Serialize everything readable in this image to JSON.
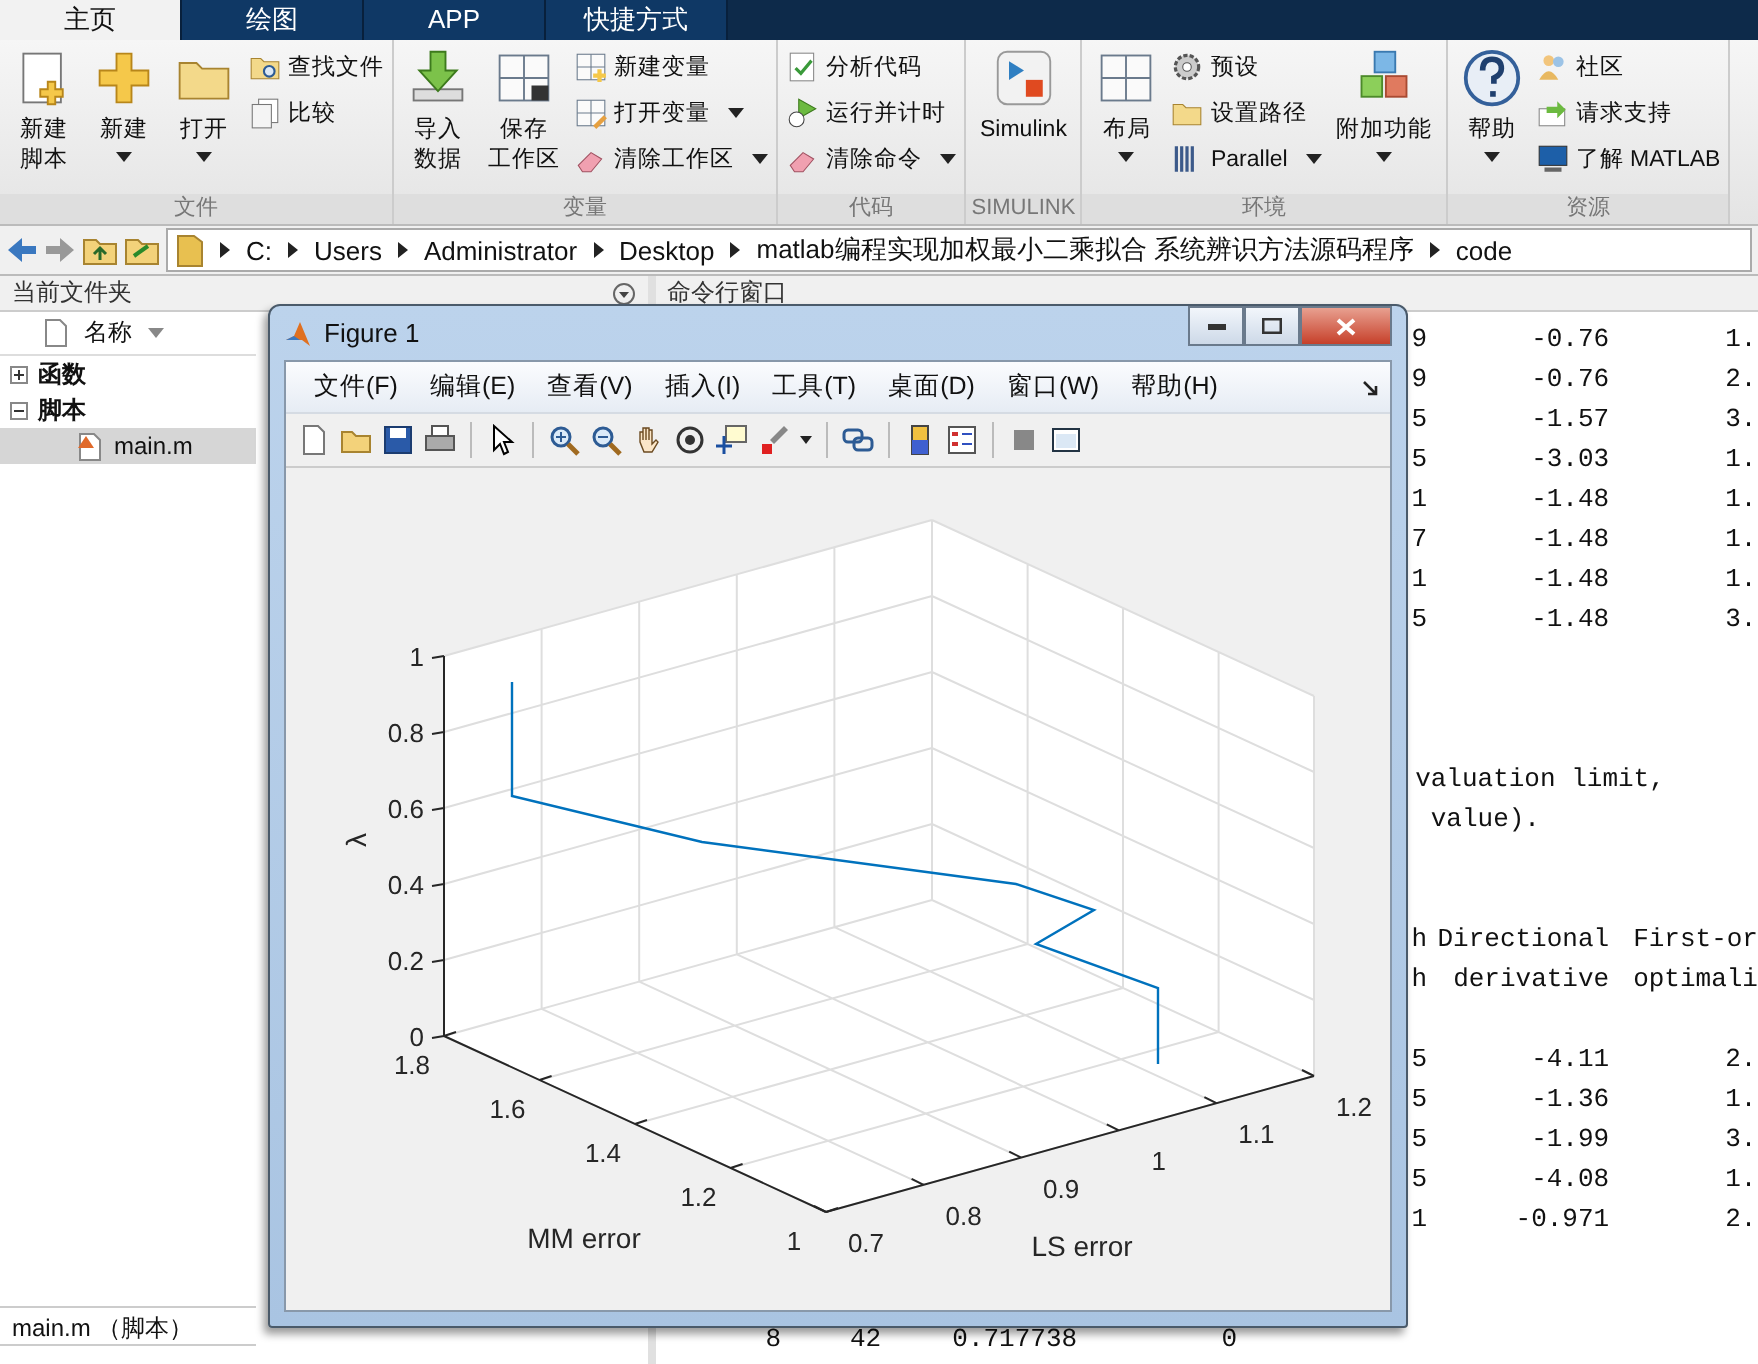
{
  "tabs": [
    {
      "label": "主页",
      "selected": true
    },
    {
      "label": "绘图",
      "selected": false
    },
    {
      "label": "APP",
      "selected": false
    },
    {
      "label": "快捷方式",
      "selected": false
    }
  ],
  "ribbon": {
    "groups": [
      {
        "label": "文件",
        "items": [
          {
            "kind": "large",
            "lines": [
              "新建",
              "脚本"
            ],
            "dropdown": false
          },
          {
            "kind": "large",
            "lines": [
              "新建"
            ],
            "dropdown": true
          },
          {
            "kind": "large",
            "lines": [
              "打开"
            ],
            "dropdown": true
          },
          {
            "kind": "stack",
            "items": [
              {
                "label": "查找文件",
                "dropdown": false
              },
              {
                "label": "比较",
                "dropdown": false
              }
            ]
          }
        ]
      },
      {
        "label": "变量",
        "items": [
          {
            "kind": "large",
            "lines": [
              "导入",
              "数据"
            ],
            "dropdown": false
          },
          {
            "kind": "large",
            "lines": [
              "保存",
              "工作区"
            ],
            "dropdown": false
          },
          {
            "kind": "stack",
            "items": [
              {
                "label": "新建变量",
                "dropdown": false
              },
              {
                "label": "打开变量",
                "dropdown": true
              },
              {
                "label": "清除工作区",
                "dropdown": true
              }
            ]
          }
        ]
      },
      {
        "label": "代码",
        "items": [
          {
            "kind": "stack",
            "items": [
              {
                "label": "分析代码",
                "dropdown": false
              },
              {
                "label": "运行并计时",
                "dropdown": false
              },
              {
                "label": "清除命令",
                "dropdown": true
              }
            ]
          }
        ]
      },
      {
        "label": "SIMULINK",
        "items": [
          {
            "kind": "large",
            "lines": [
              "Simulink"
            ],
            "dropdown": false
          }
        ]
      },
      {
        "label": "环境",
        "items": [
          {
            "kind": "large",
            "lines": [
              "布局"
            ],
            "dropdown": true
          },
          {
            "kind": "stack",
            "items": [
              {
                "label": "预设",
                "dropdown": false
              },
              {
                "label": "设置路径",
                "dropdown": false
              },
              {
                "label": "Parallel",
                "dropdown": true
              }
            ]
          },
          {
            "kind": "large",
            "lines": [
              "附加功能"
            ],
            "dropdown": true
          }
        ]
      },
      {
        "label": "资源",
        "items": [
          {
            "kind": "large",
            "lines": [
              "帮助"
            ],
            "dropdown": true
          },
          {
            "kind": "stack",
            "items": [
              {
                "label": "社区",
                "dropdown": false
              },
              {
                "label": "请求支持",
                "dropdown": false
              },
              {
                "label": "了解 MATLAB",
                "dropdown": false
              }
            ]
          }
        ]
      }
    ]
  },
  "address_bar": {
    "path": [
      "C:",
      "Users",
      "Administrator",
      "Desktop",
      "matlab编程实现加权最小二乘拟合 系统辨识方法源码程序",
      "code"
    ]
  },
  "current_folder": {
    "title": "当前文件夹",
    "column": "名称",
    "tree": [
      {
        "label": "函数",
        "expanded": false
      },
      {
        "label": "脚本",
        "expanded": true,
        "children": [
          {
            "label": "main.m",
            "selected": true
          }
        ]
      }
    ],
    "status": "main.m （脚本）"
  },
  "command_window": {
    "title": "命令行窗口",
    "lines": [
      {
        "kind": "row",
        "cells": [
          "9",
          "-0.76",
          "1."
        ]
      },
      {
        "kind": "row",
        "cells": [
          "9",
          "-0.76",
          "2."
        ]
      },
      {
        "kind": "row",
        "cells": [
          "5",
          "-1.57",
          "3."
        ]
      },
      {
        "kind": "row",
        "cells": [
          "5",
          "-3.03",
          "1."
        ]
      },
      {
        "kind": "row",
        "cells": [
          "1",
          "-1.48",
          "1."
        ]
      },
      {
        "kind": "row",
        "cells": [
          "7",
          "-1.48",
          "1."
        ]
      },
      {
        "kind": "row",
        "cells": [
          "1",
          "-1.48",
          "1."
        ]
      },
      {
        "kind": "row",
        "cells": [
          "5",
          "-1.48",
          "3."
        ]
      },
      {
        "kind": "gap"
      },
      {
        "kind": "gap"
      },
      {
        "kind": "gap"
      },
      {
        "kind": "text",
        "text": "valuation limit,"
      },
      {
        "kind": "text",
        "text": " value)."
      },
      {
        "kind": "gap"
      },
      {
        "kind": "gap"
      },
      {
        "kind": "header",
        "cells": [
          "h",
          "Directional",
          "First-or"
        ]
      },
      {
        "kind": "header",
        "cells": [
          "h",
          "derivative",
          "optimali"
        ]
      },
      {
        "kind": "gap"
      },
      {
        "kind": "row",
        "cells": [
          "5",
          "-4.11",
          "2."
        ]
      },
      {
        "kind": "row",
        "cells": [
          "5",
          "-1.36",
          "1."
        ]
      },
      {
        "kind": "row",
        "cells": [
          "5",
          "-1.99",
          "3."
        ]
      },
      {
        "kind": "row",
        "cells": [
          "5",
          "-4.08",
          "1."
        ]
      },
      {
        "kind": "row",
        "cells": [
          "1",
          "-0.971",
          "2."
        ]
      },
      {
        "kind": "gap"
      },
      {
        "kind": "gap"
      },
      {
        "kind": "full",
        "cells": [
          "8",
          "42",
          "0.717738",
          "0"
        ]
      }
    ]
  },
  "figure": {
    "title": "Figure 1",
    "menu": [
      "文件(F)",
      "编辑(E)",
      "查看(V)",
      "插入(I)",
      "工具(T)",
      "桌面(D)",
      "窗口(W)",
      "帮助(H)"
    ],
    "axes": {
      "z_label": "λ",
      "y_label": "MM error",
      "x_label": "LS error",
      "z_ticks": [
        "1",
        "0.8",
        "0.6",
        "0.4",
        "0.2",
        "0"
      ],
      "y_ticks": [
        "1",
        "1.2",
        "1.4",
        "1.6",
        "1.8"
      ],
      "x_ticks": [
        "0.7",
        "0.8",
        "0.9",
        "1",
        "1.1",
        "1.2"
      ]
    }
  }
}
